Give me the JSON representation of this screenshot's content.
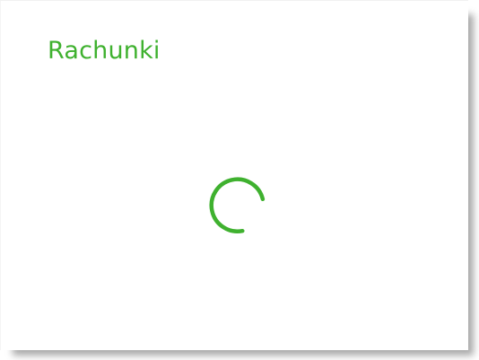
{
  "card": {
    "title": "Rachunki",
    "status": "loading",
    "spinner_icon": "loading-spinner-icon"
  },
  "colors": {
    "accent": "#3fb12f",
    "background": "#ffffff"
  }
}
